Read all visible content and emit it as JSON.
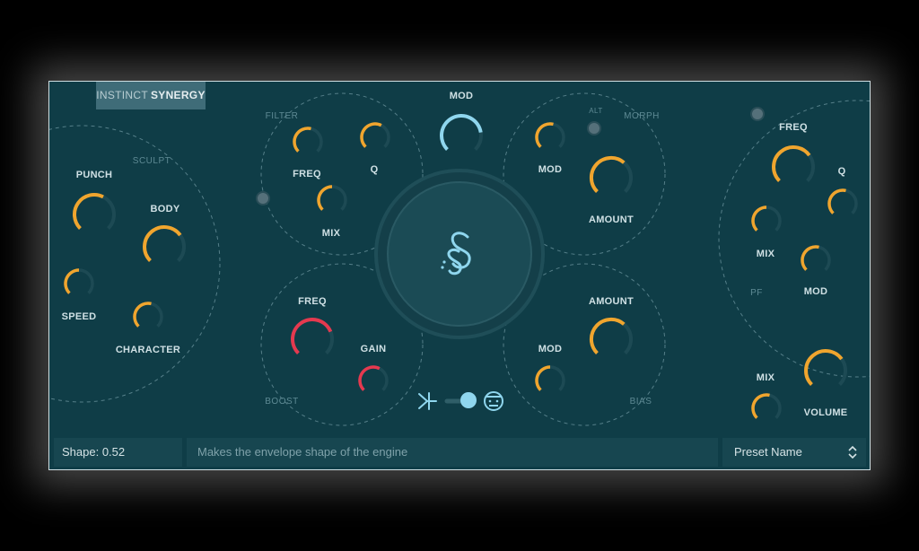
{
  "brand": {
    "prefix": "INSTINCT",
    "name": "SYNERGY"
  },
  "sections": {
    "sculpt": "SCULPT",
    "filter": "FILTER",
    "morph": "MORPH",
    "alt": "ALT",
    "boost": "BOOST",
    "bias": "BIAS",
    "pf": "PF"
  },
  "labels": {
    "punch": "PUNCH",
    "body": "BODY",
    "speed": "SPEED",
    "character": "CHARACTER",
    "filter_freq": "FREQ",
    "filter_q": "Q",
    "filter_mix": "MIX",
    "mod_top": "MOD",
    "morph_mod": "MOD",
    "morph_amount": "AMOUNT",
    "boost_freq": "FREQ",
    "boost_gain": "GAIN",
    "bias_amount": "AMOUNT",
    "bias_mod": "MOD",
    "pf_freq": "FREQ",
    "pf_q": "Q",
    "pf_mix": "MIX",
    "pf_mod": "MOD",
    "out_mix": "MIX",
    "volume": "VOLUME"
  },
  "colors": {
    "orange": "#f0a52e",
    "red": "#e5394f",
    "blue": "#8fd6ee",
    "track": "#1d4a54"
  },
  "knob_levels": {
    "punch": 0.6,
    "body": 0.7,
    "speed": 0.5,
    "character": 0.55,
    "filter_freq": 0.55,
    "filter_q": 0.6,
    "filter_mix": 0.5,
    "mod_top": 0.8,
    "morph_mod": 0.55,
    "morph_amount": 0.65,
    "boost_freq": 0.75,
    "boost_gain": 0.6,
    "bias_amount": 0.65,
    "bias_mod": 0.5,
    "pf_freq": 0.7,
    "pf_q": 0.55,
    "pf_mix": 0.5,
    "pf_mod": 0.55,
    "out_mix": 0.55,
    "volume": 0.7
  },
  "footer": {
    "status": "Shape: 0.52",
    "hint": "Makes the envelope shape of the engine",
    "preset": "Preset Name"
  },
  "icons": {
    "center_logo": "synergy-s-logo-icon",
    "mode_left": "fork-icon",
    "mode_right": "robot-face-icon",
    "preset_arrows": "up-down-arrows-icon"
  }
}
